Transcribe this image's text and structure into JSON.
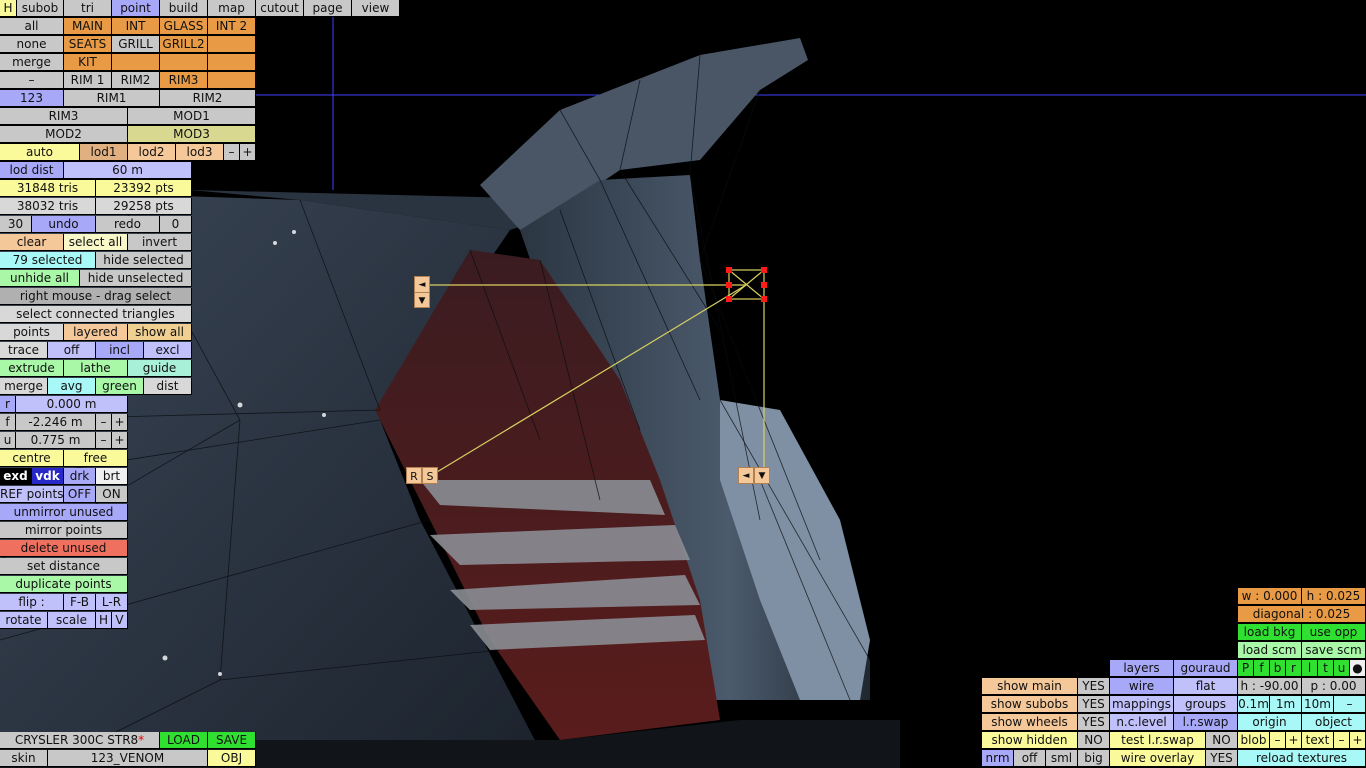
{
  "menu": {
    "h": "H",
    "subob": "subob",
    "tri": "tri",
    "point": "point",
    "build": "build",
    "map": "map",
    "cutout": "cutout",
    "page": "page",
    "view": "view"
  },
  "parts": {
    "all": "all",
    "none": "none",
    "merge": "merge",
    "dash": "–",
    "count": "123",
    "main": "MAIN",
    "int": "INT",
    "glass": "GLASS",
    "int2": "INT 2",
    "seats": "SEATS",
    "grill": "GRILL",
    "grill2": "GRILL2",
    "kit": "KIT",
    "rim1a": "RIM 1",
    "rim2a": "RIM2",
    "rim3a": "RIM3",
    "rim1b": "RIM1",
    "rim2b": "RIM2",
    "rim3": "RIM3",
    "mod1": "MOD1",
    "mod2": "MOD2",
    "mod3": "MOD3"
  },
  "lod": {
    "auto": "auto",
    "lod1": "lod1",
    "lod2": "lod2",
    "lod3": "lod3",
    "minus": "–",
    "plus": "+"
  },
  "stats": {
    "lod_dist_label": "lod dist",
    "lod_dist": "60 m",
    "tris1": "31848 tris",
    "pts1": "23392 pts",
    "tris2": "38032 tris",
    "pts2": "29258 pts",
    "undo_count": "30",
    "undo": "undo",
    "redo": "redo",
    "redo_count": "0"
  },
  "select": {
    "clear": "clear",
    "select_all": "select all",
    "invert": "invert",
    "selected": "79 selected",
    "hide_selected": "hide selected",
    "unhide_all": "unhide all",
    "hide_unselected": "hide unselected",
    "right_mouse": "right mouse - drag select",
    "connected": "select connected triangles",
    "points": "points",
    "layered": "layered",
    "show_all": "show all",
    "trace": "trace",
    "off": "off",
    "incl": "incl",
    "excl": "excl",
    "extrude": "extrude",
    "lathe": "lathe",
    "guide": "guide",
    "merge": "merge",
    "avg": "avg",
    "green": "green",
    "dist": "dist"
  },
  "coords": {
    "r_label": "r",
    "r": "0.000 m",
    "f_label": "f",
    "f": "-2.246 m",
    "u_label": "u",
    "u": "0.775 m",
    "minus": "–",
    "plus": "+",
    "centre": "centre",
    "free": "free",
    "exd": "exd",
    "vdk": "vdk",
    "drk": "drk",
    "brt": "brt",
    "ref_points": "REF points",
    "off": "OFF",
    "on": "ON",
    "unmirror": "unmirror unused",
    "mirror": "mirror points",
    "delete_unused": "delete unused",
    "set_distance": "set distance",
    "duplicate": "duplicate points",
    "flip": "flip :",
    "fb": "F-B",
    "lr": "L-R",
    "rotate": "rotate",
    "scale": "scale",
    "h": "H",
    "v": "V"
  },
  "file": {
    "car_name": "CRYSLER 300C STR8",
    "star": "*",
    "load": "LOAD",
    "save": "SAVE",
    "skin": "skin",
    "skin_name": "123_VENOM",
    "obj": "OBJ"
  },
  "overlay_tags": {
    "left_arrow": "◄",
    "down_arrow": "▼",
    "r": "R",
    "s": "S"
  },
  "right_panel": {
    "w": "w : 0.000",
    "h": "h : 0.025",
    "diagonal": "diagonal : 0.025",
    "load_bkg": "load bkg",
    "use_opp": "use opp",
    "load_scm": "load scm",
    "save_scm": "save scm",
    "flags": [
      "P",
      "f",
      "b",
      "r",
      "l",
      "t",
      "u",
      "●"
    ],
    "h_angle": "h : -90.00",
    "p_angle": "p : 0.00",
    "step1": "0.1m",
    "step2": "1m",
    "step3": "10m",
    "step_minus": "–",
    "origin": "origin",
    "object": "object",
    "blob": "blob",
    "text": "text",
    "minus": "–",
    "plus": "+",
    "reload": "reload textures"
  },
  "view_panel": {
    "layers": "layers",
    "gouraud": "gouraud",
    "wire": "wire",
    "flat": "flat",
    "mappings": "mappings",
    "groups": "groups",
    "nc_level": "n.c.level",
    "lr_swap": "l.r.swap",
    "test_lr_swap": "test l.r.swap",
    "no": "NO",
    "wire_overlay": "wire overlay",
    "yes": "YES",
    "show_main": "show main",
    "show_subobs": "show subobs",
    "show_wheels": "show wheels",
    "show_hidden": "show hidden",
    "nrm": "nrm",
    "off": "off",
    "sml": "sml",
    "big": "big"
  }
}
